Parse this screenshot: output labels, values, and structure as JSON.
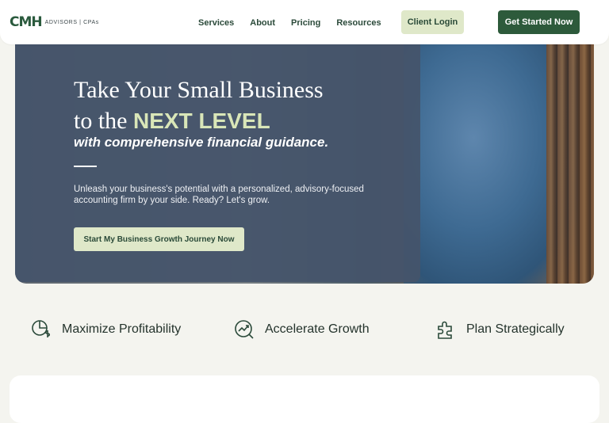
{
  "brand": {
    "logo_mark": "CMH",
    "logo_text": "ADVISORS | CPAs"
  },
  "nav": {
    "items": [
      "Services",
      "About",
      "Pricing",
      "Resources"
    ],
    "login_label": "Client Login",
    "start_label": "Get Started Now"
  },
  "hero": {
    "title_line1": "Take Your Small Business",
    "title_line2_prefix": "to the ",
    "title_line2_accent": "NEXT LEVEL",
    "subtitle": "with comprehensive financial guidance.",
    "description": "Unleash your business's potential with a personalized, advisory-focused accounting firm by your side. Ready? Let's grow.",
    "cta_label": "Start My Business Growth Journey Now"
  },
  "features": [
    {
      "icon": "profit-icon",
      "label": "Maximize Profitability"
    },
    {
      "icon": "growth-icon",
      "label": "Accelerate Growth"
    },
    {
      "icon": "puzzle-icon",
      "label": "Plan Strategically"
    }
  ],
  "colors": {
    "brand_green": "#2d5a3b",
    "accent_lime": "#dfe8c9",
    "hero_overlay": "#45546b",
    "page_bg": "#f4f4ef"
  }
}
